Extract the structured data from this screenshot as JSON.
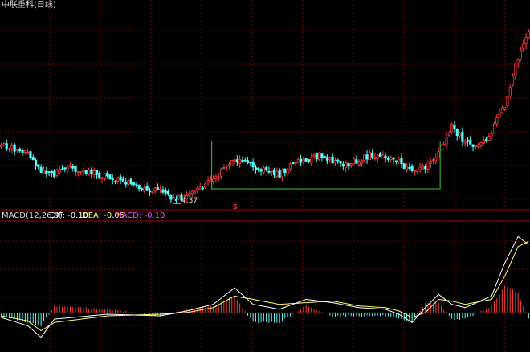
{
  "title": "中联重科(日线)",
  "colors": {
    "background": "#000000",
    "grid": "#7a0000",
    "up": "#ff3b3b",
    "down": "#54ffff",
    "dif": "#ffffff",
    "dea": "#ffff66",
    "macd_label": "#ff55ff",
    "box": "#33cc33",
    "text": "#dddddd"
  },
  "price_chart": {
    "low_label": "4.37",
    "marker_glyph": "S",
    "marker_text": "S",
    "consolidation_box_days": [
      80,
      165
    ]
  },
  "macd_panel": {
    "params_label": "MACD(12,26,9)",
    "dif_label": "DIF: -0.10",
    "dea_label": "DEA: -0.05",
    "macd_label": "MACD: -0.10"
  },
  "chart_data": {
    "type": "candlestick",
    "stock": "中联重科",
    "period": "日线",
    "days": 200,
    "price_points": [
      [
        0,
        5.45
      ],
      [
        10,
        5.28
      ],
      [
        15,
        4.95
      ],
      [
        20,
        4.9
      ],
      [
        25,
        5.05
      ],
      [
        35,
        4.92
      ],
      [
        45,
        4.8
      ],
      [
        55,
        4.62
      ],
      [
        60,
        4.6
      ],
      [
        65,
        4.45
      ],
      [
        70,
        4.5
      ],
      [
        75,
        4.65
      ],
      [
        80,
        4.82
      ],
      [
        85,
        5.05
      ],
      [
        90,
        5.2
      ],
      [
        100,
        4.95
      ],
      [
        105,
        4.9
      ],
      [
        110,
        5.12
      ],
      [
        120,
        5.25
      ],
      [
        130,
        5.08
      ],
      [
        140,
        5.28
      ],
      [
        150,
        5.15
      ],
      [
        155,
        4.95
      ],
      [
        160,
        5.05
      ],
      [
        165,
        5.3
      ],
      [
        170,
        5.78
      ],
      [
        175,
        5.5
      ],
      [
        180,
        5.4
      ],
      [
        185,
        5.7
      ],
      [
        190,
        6.2
      ],
      [
        195,
        7.05
      ],
      [
        200,
        7.6
      ]
    ],
    "price_range": [
      4.3,
      8.0
    ],
    "macd": {
      "dif_points": [
        [
          0,
          -0.03
        ],
        [
          10,
          -0.08
        ],
        [
          15,
          -0.15
        ],
        [
          20,
          -0.04
        ],
        [
          40,
          -0.01
        ],
        [
          60,
          -0.02
        ],
        [
          70,
          0.01
        ],
        [
          80,
          0.05
        ],
        [
          88,
          0.15
        ],
        [
          95,
          0.05
        ],
        [
          105,
          0.02
        ],
        [
          115,
          0.08
        ],
        [
          125,
          0.06
        ],
        [
          135,
          0.03
        ],
        [
          145,
          0.02
        ],
        [
          150,
          -0.01
        ],
        [
          155,
          -0.06
        ],
        [
          160,
          0.03
        ],
        [
          165,
          0.11
        ],
        [
          170,
          0.05
        ],
        [
          175,
          0.03
        ],
        [
          185,
          0.1
        ],
        [
          190,
          0.3
        ],
        [
          195,
          0.46
        ],
        [
          200,
          0.4
        ]
      ],
      "dea_points": [
        [
          0,
          -0.02
        ],
        [
          10,
          -0.05
        ],
        [
          15,
          -0.11
        ],
        [
          20,
          -0.06
        ],
        [
          40,
          -0.02
        ],
        [
          60,
          -0.01
        ],
        [
          70,
          0.0
        ],
        [
          80,
          0.03
        ],
        [
          88,
          0.1
        ],
        [
          95,
          0.08
        ],
        [
          105,
          0.05
        ],
        [
          115,
          0.06
        ],
        [
          125,
          0.07
        ],
        [
          135,
          0.04
        ],
        [
          145,
          0.03
        ],
        [
          150,
          0.01
        ],
        [
          155,
          -0.03
        ],
        [
          160,
          0.0
        ],
        [
          165,
          0.08
        ],
        [
          170,
          0.07
        ],
        [
          175,
          0.05
        ],
        [
          185,
          0.08
        ],
        [
          190,
          0.22
        ],
        [
          195,
          0.4
        ],
        [
          200,
          0.44
        ]
      ],
      "range": [
        -0.2,
        0.55
      ],
      "last_dif": -0.1,
      "last_dea": -0.05,
      "last_macd": -0.1
    },
    "grid": true,
    "legend": "top-left"
  }
}
